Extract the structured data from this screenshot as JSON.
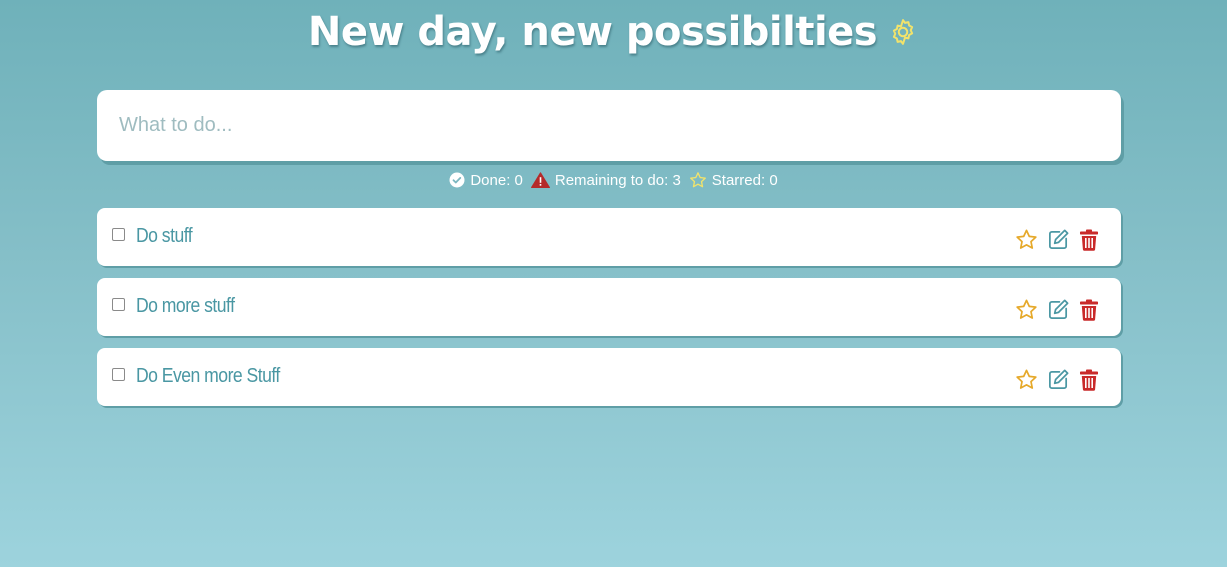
{
  "header": {
    "title": "New day, new possibilties",
    "settings_icon": "gear-icon",
    "settings_icon_color": "#f2e36b"
  },
  "new_todo": {
    "placeholder": "What to do...",
    "value": ""
  },
  "stats": {
    "done_label": "Done: 0",
    "remaining_label": "Remaining to do: 3",
    "starred_label": "Starred: 0"
  },
  "todos": [
    {
      "text": "Do stuff",
      "checked": false,
      "starred": false
    },
    {
      "text": "Do more stuff",
      "checked": false,
      "starred": false
    },
    {
      "text": "Do Even more Stuff",
      "checked": false,
      "starred": false
    }
  ],
  "colors": {
    "star": "#e6a92a",
    "edit": "#4a97a3",
    "delete": "#c92a2a",
    "warning": "#b52a2a"
  }
}
